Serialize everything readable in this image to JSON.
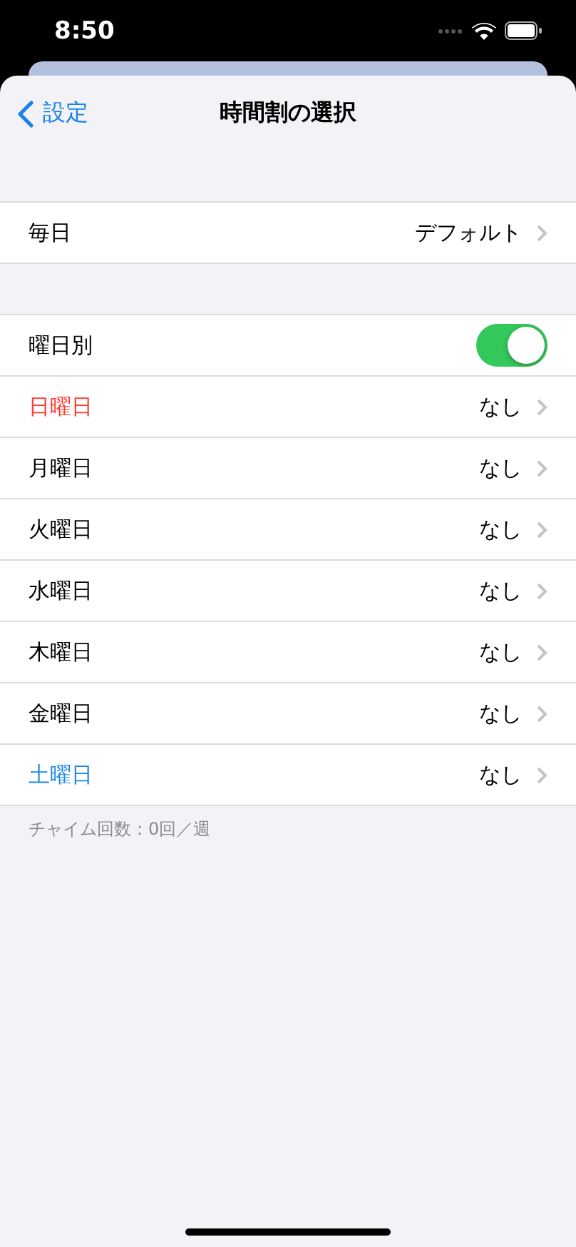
{
  "status_bar": {
    "time": "8:50"
  },
  "nav": {
    "back": "設定",
    "title": "時間割の選択"
  },
  "default_row": {
    "label": "毎日",
    "value": "デフォルト"
  },
  "weekday_section": {
    "rows": [
      {
        "kind": "toggle",
        "label": "曜日別",
        "on": true
      },
      {
        "kind": "link",
        "label": "日曜日",
        "value": "なし",
        "color": "#ff3b30"
      },
      {
        "kind": "link",
        "label": "月曜日",
        "value": "なし",
        "color": "#000000"
      },
      {
        "kind": "link",
        "label": "火曜日",
        "value": "なし",
        "color": "#000000"
      },
      {
        "kind": "link",
        "label": "水曜日",
        "value": "なし",
        "color": "#000000"
      },
      {
        "kind": "link",
        "label": "木曜日",
        "value": "なし",
        "color": "#000000"
      },
      {
        "kind": "link",
        "label": "金曜日",
        "value": "なし",
        "color": "#000000"
      },
      {
        "kind": "link",
        "label": "土曜日",
        "value": "なし",
        "color": "#1e88e5"
      }
    ],
    "footer": "チャイム回数：0回／週"
  }
}
